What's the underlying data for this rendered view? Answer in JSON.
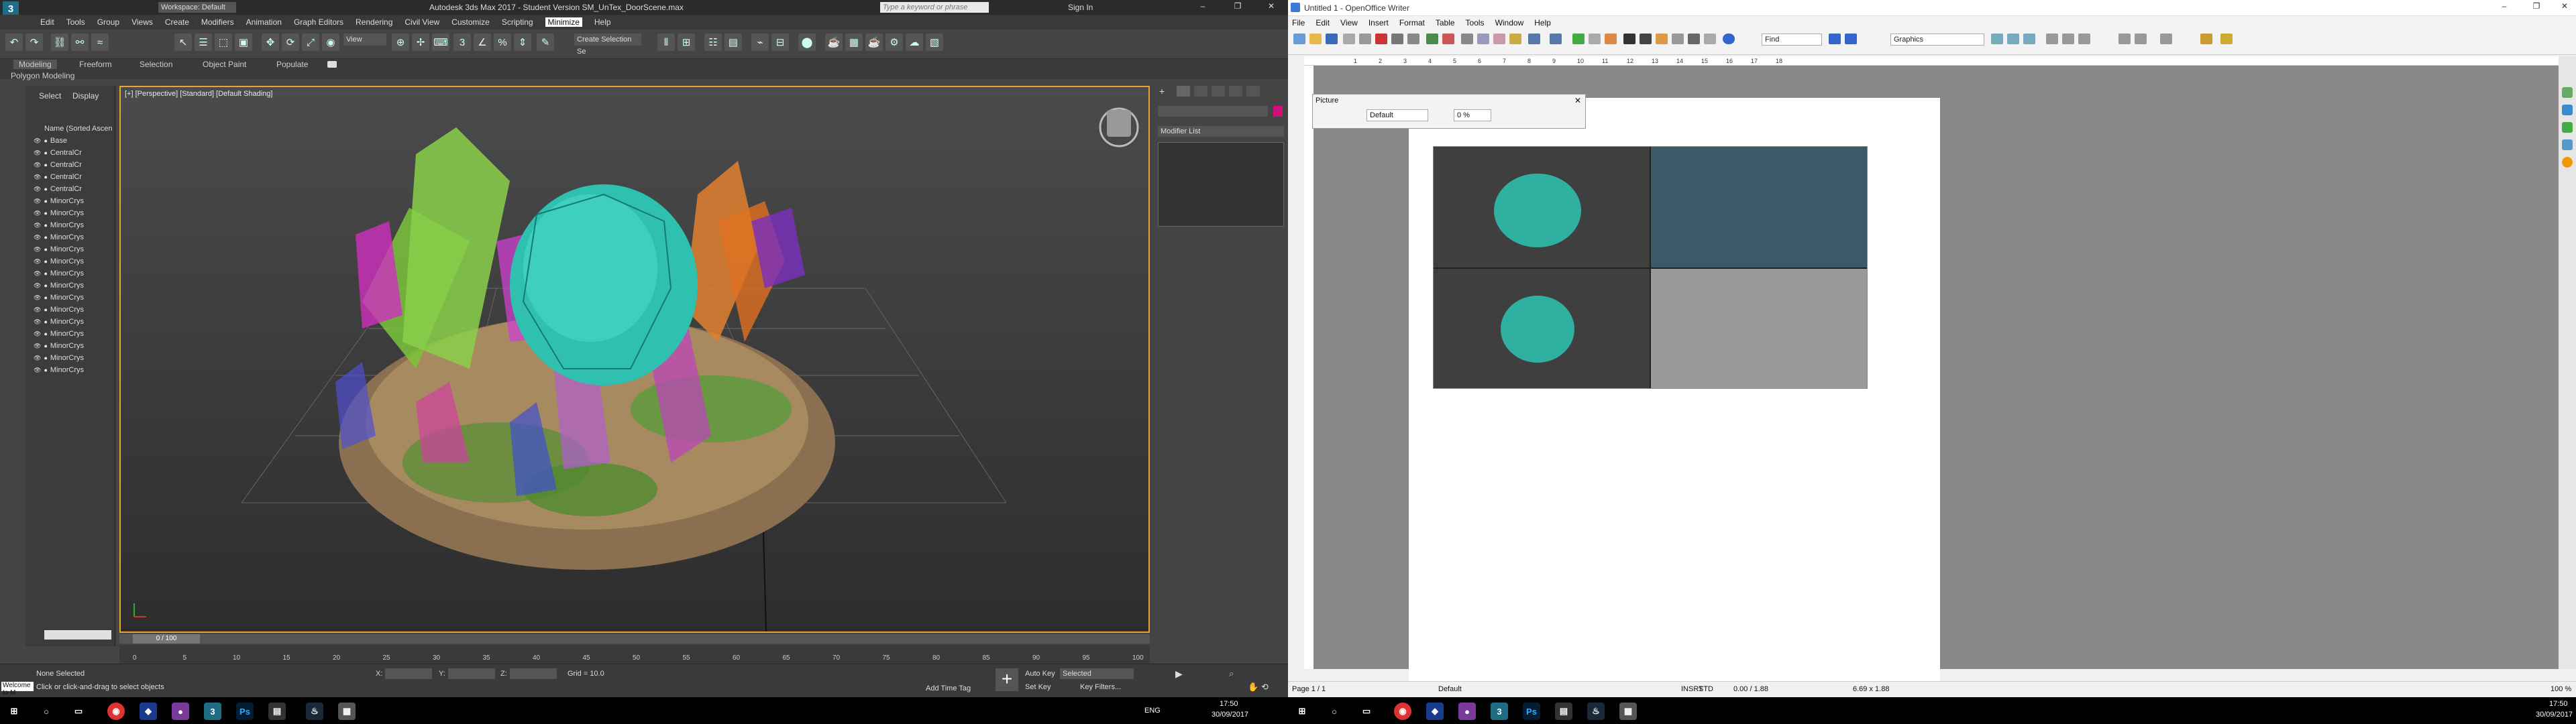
{
  "max": {
    "workspace": "Workspace: Default",
    "title": "Autodesk 3ds Max 2017 - Student Version   SM_UnTex_DoorScene.max",
    "search_placeholder": "Type a keyword or phrase",
    "sign_in": "Sign In",
    "menus": [
      "Edit",
      "Tools",
      "Group",
      "Views",
      "Create",
      "Modifiers",
      "Animation",
      "Graph Editors",
      "Rendering",
      "Civil View",
      "Customize",
      "Scripting",
      "Minimize",
      "Help"
    ],
    "tooltip": "Minimize",
    "view_combo": "View",
    "selection_set": "Create Selection Se",
    "ribbon_tabs": [
      "Modeling",
      "Freeform",
      "Selection",
      "Object Paint",
      "Populate"
    ],
    "ribbon_sub": "Polygon Modeling",
    "explorer": {
      "tabs": [
        "Select",
        "Display"
      ],
      "header": "Name (Sorted Ascen",
      "items": [
        "Base",
        "CentralCr",
        "CentralCr",
        "CentralCr",
        "CentralCr",
        "MinorCrys",
        "MinorCrys",
        "MinorCrys",
        "MinorCrys",
        "MinorCrys",
        "MinorCrys",
        "MinorCrys",
        "MinorCrys",
        "MinorCrys",
        "MinorCrys",
        "MinorCrys",
        "MinorCrys",
        "MinorCrys",
        "MinorCrys",
        "MinorCrys"
      ]
    },
    "viewport_label": "[+] [Perspective] [Standard] [Default Shading]",
    "modifier_list": "Modifier List",
    "time_counter": "0 / 100",
    "ticks": [
      "0",
      "5",
      "10",
      "15",
      "20",
      "25",
      "30",
      "35",
      "40",
      "45",
      "50",
      "55",
      "60",
      "65",
      "70",
      "75",
      "80",
      "85",
      "90",
      "95",
      "100"
    ],
    "status": {
      "maxscript": "Welcome to M",
      "selected": "None Selected",
      "prompt": "Click or click-and-drag to select objects",
      "x_label": "X:",
      "y_label": "Y:",
      "z_label": "Z:",
      "grid": "Grid = 10.0",
      "add_time_tag": "Add Time Tag",
      "auto_key": "Auto Key",
      "set_key": "Set Key",
      "selected_combo": "Selected",
      "key_filters": "Key Filters..."
    }
  },
  "writer": {
    "title": "Untitled 1 - OpenOffice Writer",
    "menus": [
      "File",
      "Edit",
      "View",
      "Insert",
      "Format",
      "Table",
      "Tools",
      "Window",
      "Help"
    ],
    "find": "Find",
    "style_combo": "Graphics",
    "picture_toolbar": {
      "title": "Picture",
      "mode": "Default",
      "percent": "0 %"
    },
    "ruler": [
      "1",
      "2",
      "3",
      "4",
      "5",
      "6",
      "7",
      "8",
      "9",
      "10",
      "11",
      "12",
      "13",
      "14",
      "15",
      "16",
      "17",
      "18"
    ],
    "status": {
      "page": "Page 1 / 1",
      "style": "Default",
      "insrt": "INSRT",
      "std": "STD",
      "position": "0.00 / 1.88",
      "size": "6.69 x 1.88",
      "zoom": "100 %"
    }
  },
  "taskbar": {
    "left_time": "17:50",
    "left_date": "30/09/2017",
    "right_time": "17:50",
    "right_date": "30/09/2017",
    "lang": "ENG"
  }
}
